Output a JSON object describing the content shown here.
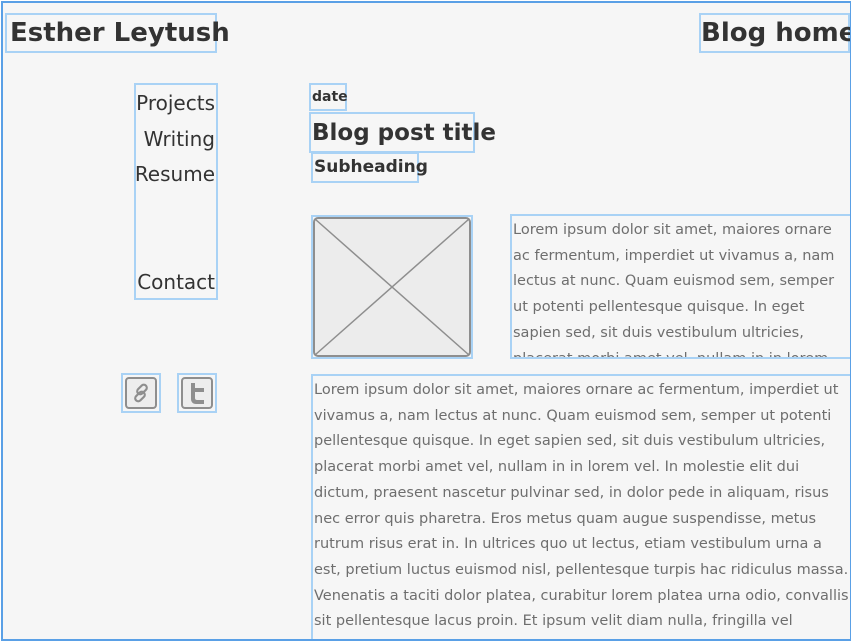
{
  "header": {
    "site_name": "Esther Leytush",
    "blog_home": "Blog home"
  },
  "nav": {
    "projects": "Projects",
    "writing": "Writing",
    "resume": "Resume",
    "contact": "Contact"
  },
  "social": {
    "icons": [
      "link-icon",
      "twitter-icon"
    ]
  },
  "post": {
    "date": "date",
    "title": "Blog post title",
    "subheading": "Subheading",
    "side_text": "Lorem ipsum dolor sit amet, maiores ornare ac fermentum, imperdiet ut vivamus a, nam lectus at nunc. Quam euismod sem, semper ut potenti pellentesque quisque. In eget sapien sed, sit duis vestibulum ultricies, placerat morbi amet vel, nullam in in lorem vel. In",
    "body_text": "Lorem ipsum dolor sit amet, maiores ornare ac fermentum, imperdiet ut vivamus a, nam lectus at nunc. Quam euismod sem, semper ut potenti pellentesque quisque. In eget sapien sed, sit duis vestibulum ultricies, placerat morbi amet vel, nullam in in lorem vel. In molestie elit dui dictum, praesent nascetur pulvinar sed, in dolor pede in aliquam, risus nec error quis pharetra. Eros metus quam augue suspendisse, metus rutrum risus erat in.  In ultrices quo ut lectus, etiam vestibulum urna a est, pretium luctus euismod nisl, pellentesque turpis hac ridiculus massa. Venenatis a taciti dolor platea, curabitur lorem platea urna odio, convallis sit pellentesque lacus proin. Et ipsum velit diam nulla, fringilla vel tincidunt"
  },
  "colors": {
    "selection_outline": "#a9d2f5",
    "frame_border": "#5aa0e6",
    "background": "#f6f6f6",
    "placeholder_stroke": "#8e8e8e"
  }
}
